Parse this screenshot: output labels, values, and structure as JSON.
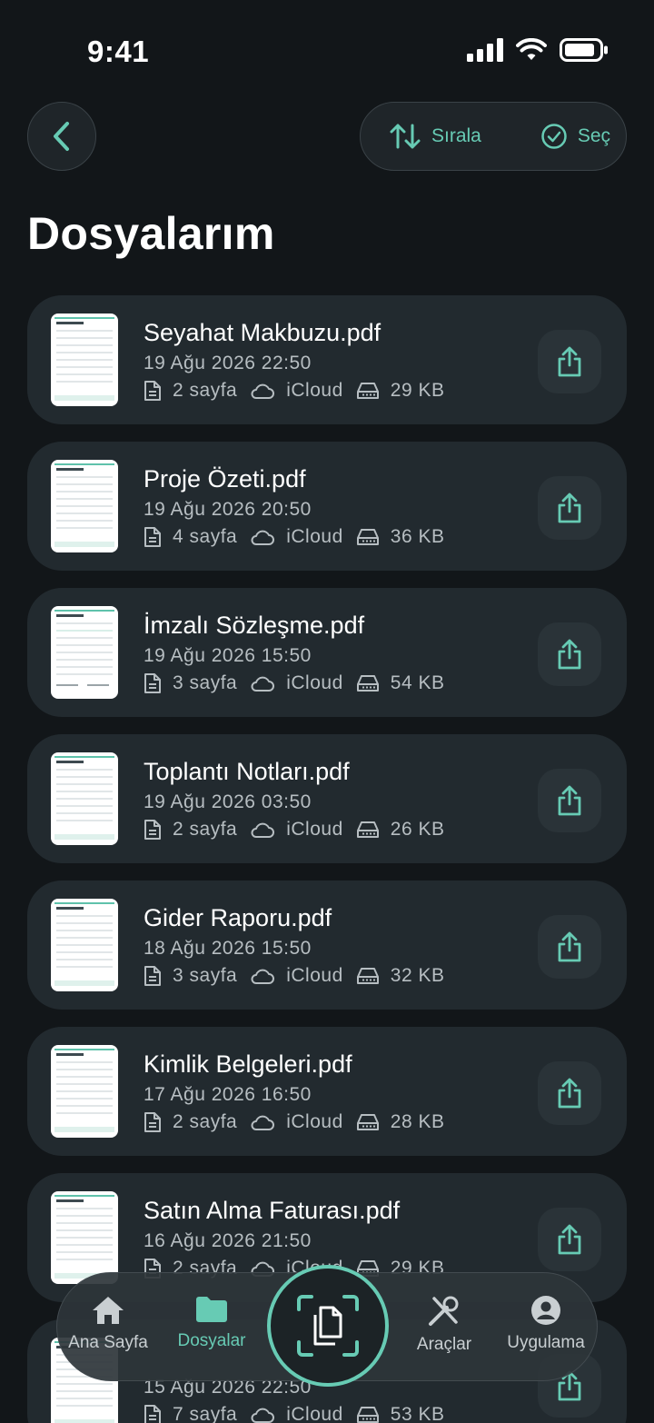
{
  "status_bar": {
    "time": "9:41"
  },
  "header": {
    "sort_label": "Sırala",
    "select_label": "Seç",
    "title": "Dosyalarım"
  },
  "files": [
    {
      "name": "Seyahat Makbuzu.pdf",
      "date": "19 Ağu 2026 22:50",
      "pages": "2 sayfa",
      "storage": "iCloud",
      "size": "29 KB"
    },
    {
      "name": "Proje Özeti.pdf",
      "date": "19 Ağu 2026 20:50",
      "pages": "4 sayfa",
      "storage": "iCloud",
      "size": "36 KB"
    },
    {
      "name": "İmzalı Sözleşme.pdf",
      "date": "19 Ağu 2026 15:50",
      "pages": "3 sayfa",
      "storage": "iCloud",
      "size": "54 KB"
    },
    {
      "name": "Toplantı Notları.pdf",
      "date": "19 Ağu 2026 03:50",
      "pages": "2 sayfa",
      "storage": "iCloud",
      "size": "26 KB"
    },
    {
      "name": "Gider Raporu.pdf",
      "date": "18 Ağu 2026 15:50",
      "pages": "3 sayfa",
      "storage": "iCloud",
      "size": "32 KB"
    },
    {
      "name": "Kimlik Belgeleri.pdf",
      "date": "17 Ağu 2026 16:50",
      "pages": "2 sayfa",
      "storage": "iCloud",
      "size": "28 KB"
    },
    {
      "name": "Satın Alma Faturası.pdf",
      "date": "16 Ağu 2026 21:50",
      "pages": "2 sayfa",
      "storage": "iCloud",
      "size": "29 KB"
    },
    {
      "name": "",
      "date": "15 Ağu 2026 22:50",
      "pages": "7 sayfa",
      "storage": "iCloud",
      "size": "53 KB"
    }
  ],
  "tab_bar": {
    "home": "Ana Sayfa",
    "files": "Dosyalar",
    "tools": "Araçlar",
    "app": "Uygulama"
  },
  "colors": {
    "accent": "#67cbb4",
    "background": "#121619",
    "card": "#222a2f"
  },
  "icons": [
    "back-chevron-icon",
    "sort-arrows-icon",
    "check-circle-icon",
    "document-icon",
    "cloud-icon",
    "storage-drive-icon",
    "share-icon",
    "home-icon",
    "folder-icon",
    "scan-icon",
    "tools-icon",
    "profile-icon"
  ]
}
